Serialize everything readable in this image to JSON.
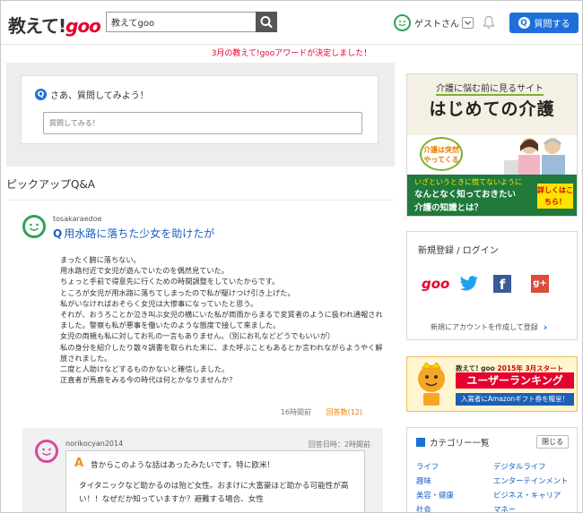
{
  "header": {
    "logo_text": "教えて!",
    "logo_goo": "goo",
    "search_value": "教えてgoo",
    "user_name": "ゲストさん",
    "ask_button": "質問する",
    "q_badge": "Q"
  },
  "award_banner": "3月の教えて!gooアワードが決定しました！",
  "ask_box": {
    "badge": "Q",
    "title": "さあ、質問してみよう！",
    "placeholder": "質問してみる！"
  },
  "pickup_heading": "ピックアップQ&A",
  "question": {
    "user": "tosakaraedoe",
    "q_mark": "Q",
    "title": "用水路に落ちた少女を助けたが",
    "body": "まったく腑に落ちない。\n用水路付近で女児が遊んでいたのを偶然見ていた。\nちょっと手前で得意先に行くための時間調整をしていたからです。\nところが女児が用水路に落ちてしまったので私が駆けつけ引き上げた。\n私がいなければおそらく女児は大惨事になっていたと思う。\nそれが、おうろことか泣き叫ぶ女児の横にいた私が両雨からまるで変質者のように扱われ通報されました。警察も私が悪事を働いたのような態度で接して来ました。\n女児の両親も私に対してお礼の一言もありません。（別にお礼などどうでもいいが）\n私の身分を紹介したり散々調書を取られた末に、また呼ぶこともあるとか言われながらようやく解放されました。\n二度と人助けなどするものかないと確信しました。\n正直者が馬鹿をみる今の時代は何とかなりませんか？",
    "time": "16時間前",
    "answer_count": "回答数(12)"
  },
  "answer": {
    "user": "norikocyan2014",
    "date": "回答日時：2時間前",
    "a_mark": "A",
    "line1": "昔からこのような話はあったみたいです。特に欧米！",
    "body": "タイタニックなど助かるのは殆ど女性。おまけに大富豪ほど助かる可能性が高い！！なぜだか知っていますか？避難する場合、女性"
  },
  "ad_care": {
    "tagline": "介護に悩む前に見るサイト",
    "title": "はじめての介護",
    "bubble": "介護は突然やってくる",
    "line1": "いざというときに慌てないように",
    "line2": "なんとなく知っておきたい",
    "line3": "介護の知識とは？",
    "detail": "詳しくはこちら！"
  },
  "login": {
    "title": "新規登録 / ログイン",
    "goo": "goo",
    "fb": "f",
    "gplus": "g+",
    "new_account": "新規にアカウントを作成して登録"
  },
  "ad_ranking": {
    "line1_prefix": "教えて! goo ",
    "line1_red": "2015年 3月スタート",
    "title": "ユーザーランキング",
    "sub": "入賞者にAmazonギフト券を贈呈！"
  },
  "categories": {
    "title": "カテゴリー一覧",
    "close": "閉じる",
    "items": [
      "ライフ",
      "デジタルライフ",
      "趣味",
      "エンターテインメント",
      "美容・健康",
      "ビジネス・キャリア",
      "社会",
      "マネー"
    ]
  },
  "colors": {
    "accent_blue": "#1e6fd9",
    "goo_red": "#e6002d",
    "guest_green": "#2ea359",
    "answer_orange": "#f08c1e"
  }
}
